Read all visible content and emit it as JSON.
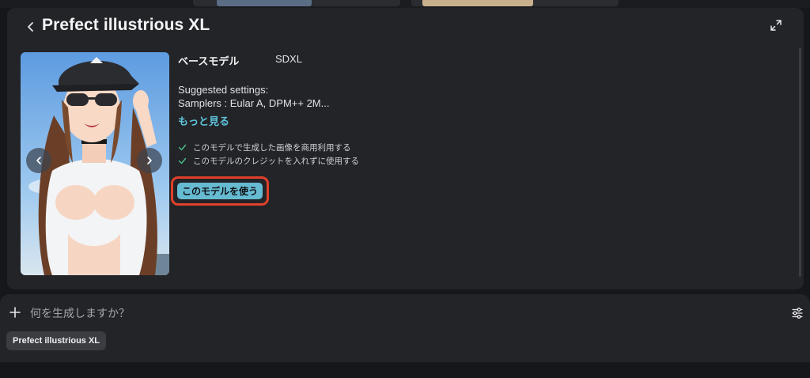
{
  "modal": {
    "title": "Prefect illustrious XL",
    "base_model_label": "ベースモデル",
    "base_model_value": "SDXL",
    "suggested_title": "Suggested settings:",
    "suggested_samplers": "Samplers : Eular A, DPM++ 2M...",
    "more_link": "もっと見る",
    "permissions": [
      "このモデルで生成した画像を商用利用する",
      "このモデルのクレジットを入れずに使用する"
    ],
    "use_button": "このモデルを使う",
    "highlight_color": "#e0402a",
    "accent_color": "#66bad1"
  },
  "composer": {
    "placeholder": "何を生成しますか？",
    "model_chip": "Prefect illustrious XL"
  },
  "icons": {
    "back": "chevron-left-icon",
    "expand": "expand-icon",
    "prev": "chevron-left-icon",
    "next": "chevron-right-icon",
    "check": "check-icon",
    "plus": "plus-icon",
    "settings": "sliders-icon"
  }
}
